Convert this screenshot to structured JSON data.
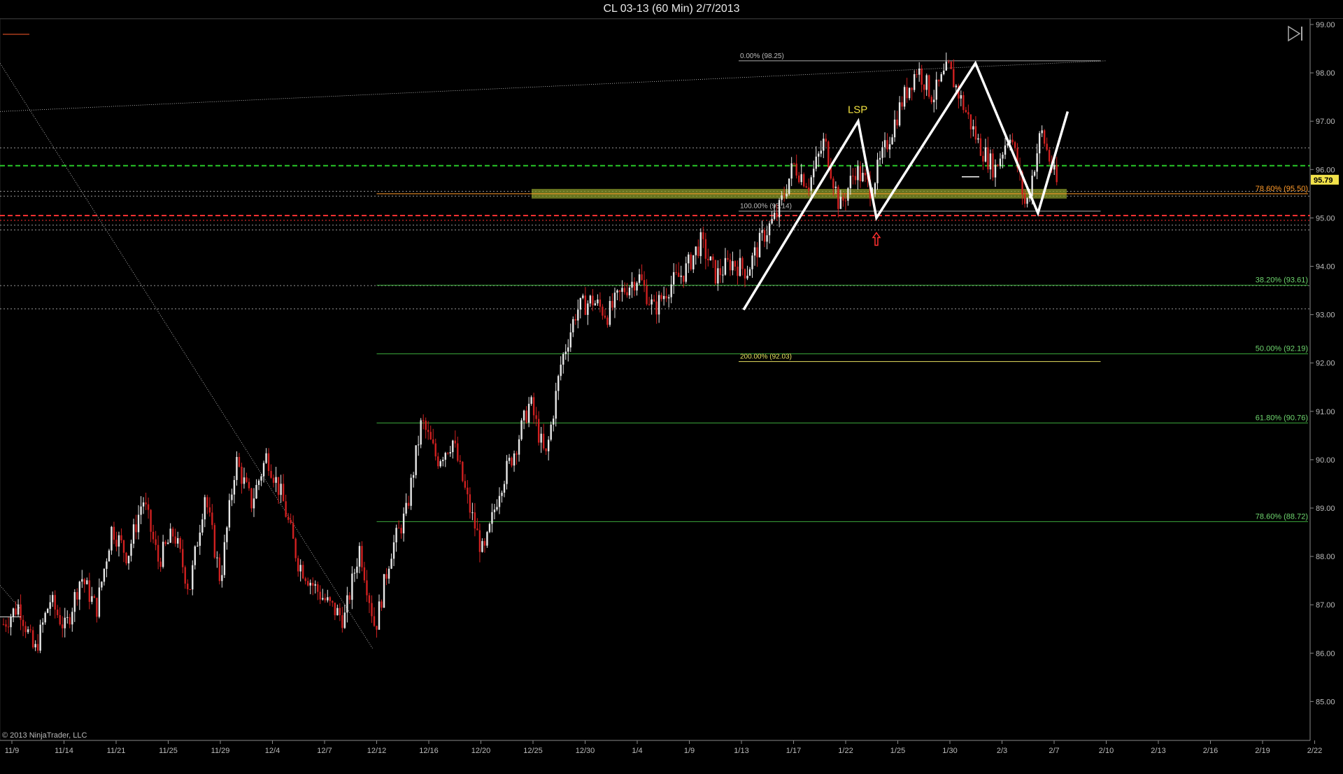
{
  "window": {
    "title": "CL 03-13 (60 Min)  2/7/2013"
  },
  "copyright": "© 2013 NinjaTrader, LLC",
  "current_price_label": "95.79",
  "colors": {
    "background": "#000000",
    "up_bar": "#e8e8e8",
    "down_bar": "#d02020",
    "fib_green": "#3caa3c",
    "fib_label_green": "#6fd66f",
    "fib_orange": "#ff9a2a",
    "support_zone": "#8a9a2a",
    "red_level": "#ff3030",
    "green_level": "#28c828",
    "pattern": "#ffffff",
    "lsp_label": "#f0e040",
    "arrow": "#ff3030"
  },
  "icons": {
    "scroll_end": "scroll-to-end-icon",
    "arrow": "up-arrow-icon"
  },
  "chart_data": {
    "type": "candlestick",
    "instrument": "CL 03-13",
    "interval": "60 Min",
    "ylim": [
      84.4,
      99.0
    ],
    "y_ticks": [
      85.0,
      86.0,
      87.0,
      88.0,
      89.0,
      90.0,
      91.0,
      92.0,
      93.0,
      94.0,
      95.0,
      96.0,
      97.0,
      98.0,
      99.0
    ],
    "x_ticks": [
      "11/9",
      "11/14",
      "11/21",
      "11/25",
      "11/29",
      "12/4",
      "12/7",
      "12/12",
      "12/16",
      "12/20",
      "12/25",
      "12/30",
      "1/4",
      "1/9",
      "1/13",
      "1/17",
      "1/22",
      "1/25",
      "1/30",
      "2/3",
      "2/7",
      "2/10",
      "2/13",
      "2/16",
      "2/19",
      "2/22"
    ],
    "price_path": [
      [
        0,
        86.6
      ],
      [
        1,
        87.0
      ],
      [
        2,
        86.0
      ],
      [
        3,
        87.1
      ],
      [
        4,
        86.5
      ],
      [
        5,
        87.6
      ],
      [
        6,
        86.9
      ],
      [
        7,
        88.6
      ],
      [
        8,
        88.0
      ],
      [
        9,
        89.2
      ],
      [
        10,
        87.9
      ],
      [
        11,
        88.5
      ],
      [
        12,
        87.3
      ],
      [
        13,
        89.3
      ],
      [
        14,
        87.5
      ],
      [
        15,
        90.0
      ],
      [
        16,
        89.1
      ],
      [
        17,
        90.1
      ],
      [
        18,
        89.2
      ],
      [
        19,
        87.9
      ],
      [
        20,
        87.4
      ],
      [
        21,
        87.0
      ],
      [
        22,
        86.7
      ],
      [
        23,
        88.2
      ],
      [
        24,
        86.5
      ],
      [
        25,
        88.1
      ],
      [
        26,
        88.9
      ],
      [
        27,
        90.8
      ],
      [
        28,
        90.0
      ],
      [
        29,
        90.4
      ],
      [
        30,
        89.1
      ],
      [
        31,
        88.0
      ],
      [
        32,
        89.4
      ],
      [
        33,
        90.2
      ],
      [
        34,
        91.2
      ],
      [
        35,
        90.0
      ],
      [
        36,
        92.0
      ],
      [
        37,
        93.1
      ],
      [
        38,
        93.3
      ],
      [
        39,
        93.0
      ],
      [
        40,
        93.5
      ],
      [
        41,
        93.8
      ],
      [
        42,
        93.1
      ],
      [
        43,
        93.6
      ],
      [
        44,
        93.9
      ],
      [
        45,
        94.5
      ],
      [
        46,
        93.8
      ],
      [
        47,
        94.1
      ],
      [
        48,
        93.9
      ],
      [
        49,
        94.6
      ],
      [
        50,
        95.1
      ],
      [
        51,
        96.1
      ],
      [
        52,
        95.7
      ],
      [
        53,
        96.6
      ],
      [
        54,
        95.2
      ],
      [
        55,
        96.0
      ],
      [
        56,
        95.6
      ],
      [
        57,
        96.5
      ],
      [
        58,
        97.4
      ],
      [
        59,
        98.1
      ],
      [
        60,
        97.5
      ],
      [
        61,
        98.1
      ],
      [
        62,
        97.3
      ],
      [
        63,
        96.5
      ],
      [
        64,
        96.0
      ],
      [
        65,
        96.8
      ],
      [
        66,
        95.2
      ],
      [
        67,
        96.8
      ],
      [
        68,
        95.7
      ]
    ],
    "price_path_x_range": [
      0,
      68
    ],
    "fibonacci_retracements": [
      {
        "label": "78.60% (95.50)",
        "price": 95.5
      },
      {
        "label": "38.20% (93.61)",
        "price": 93.61
      },
      {
        "label": "50.00% (92.19)",
        "price": 92.19
      },
      {
        "label": "61.80% (90.76)",
        "price": 90.76
      },
      {
        "label": "78.60% (88.72)",
        "price": 88.72
      }
    ],
    "fibonacci_extension": [
      {
        "label": "0.00% (98.25)",
        "price": 98.25
      },
      {
        "label": "100.00% (95.14)",
        "price": 95.14
      },
      {
        "label": "200.00% (92.03)",
        "price": 92.03
      }
    ],
    "horizontal_levels": [
      {
        "price": 96.45,
        "style": "dotted-white"
      },
      {
        "price": 96.08,
        "style": "dashed-green"
      },
      {
        "price": 95.55,
        "style": "dotted-white"
      },
      {
        "price": 95.45,
        "style": "dotted-white"
      },
      {
        "price": 95.05,
        "style": "dashed-red"
      },
      {
        "price": 94.95,
        "style": "dotted-red"
      },
      {
        "price": 94.85,
        "style": "dotted-white"
      },
      {
        "price": 94.75,
        "style": "dotted-white"
      },
      {
        "price": 93.6,
        "style": "dotted-white"
      },
      {
        "price": 93.12,
        "style": "dotted-white"
      }
    ],
    "pattern_points": [
      [
        "1/13",
        93.1
      ],
      [
        "1/22",
        97.0
      ],
      [
        "1/23",
        95.0
      ],
      [
        "1/31",
        98.2
      ],
      [
        "2/4",
        95.1
      ],
      [
        "2/7",
        97.2
      ]
    ],
    "annotations": [
      {
        "text": "LSP",
        "x": "1/22",
        "price": 97.2
      }
    ],
    "current_price": 95.79
  }
}
